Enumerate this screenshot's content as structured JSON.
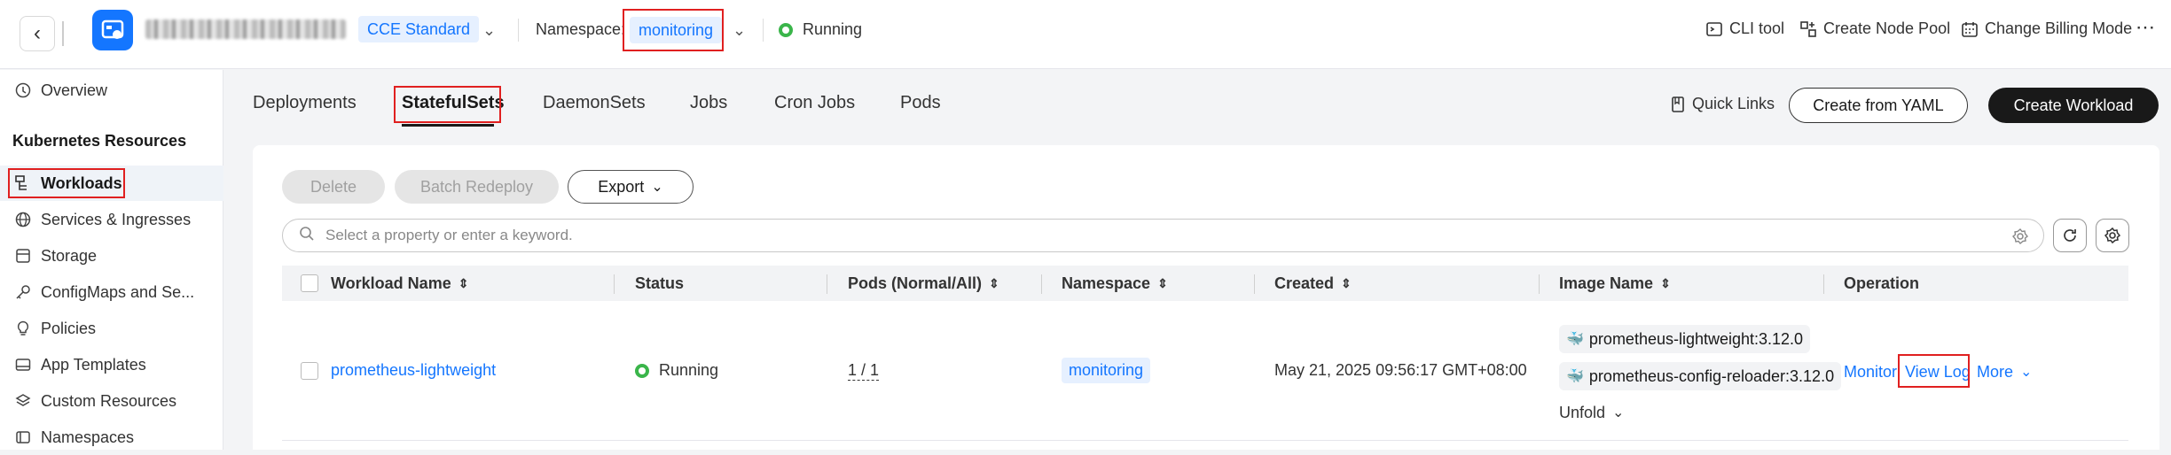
{
  "topbar": {
    "edition": "CCE Standard",
    "namespace_label": "Namespace:",
    "namespace_value": "monitoring",
    "cluster_status": "Running",
    "tools": {
      "cli": "CLI tool",
      "node_pool": "Create Node Pool",
      "billing": "Change Billing Mode",
      "more": "⋯"
    }
  },
  "sidebar": {
    "overview": "Overview",
    "section_title": "Kubernetes Resources",
    "items": [
      "Workloads",
      "Services & Ingresses",
      "Storage",
      "ConfigMaps and Se...",
      "Policies",
      "App Templates",
      "Custom Resources",
      "Namespaces"
    ]
  },
  "tabs": [
    "Deployments",
    "StatefulSets",
    "DaemonSets",
    "Jobs",
    "Cron Jobs",
    "Pods"
  ],
  "actions": {
    "quick_links": "Quick Links",
    "create_yaml": "Create from YAML",
    "create_workload": "Create Workload",
    "delete": "Delete",
    "batch_redeploy": "Batch Redeploy",
    "export": "Export"
  },
  "search": {
    "placeholder": "Select a property or enter a keyword."
  },
  "table": {
    "headers": [
      "Workload Name",
      "Status",
      "Pods (Normal/All)",
      "Namespace",
      "Created",
      "Image Name",
      "Operation"
    ],
    "rows": [
      {
        "name": "prometheus-lightweight",
        "status": "Running",
        "pods": "1 / 1",
        "namespace": "monitoring",
        "created": "May 21, 2025 09:56:17 GMT+08:00",
        "images": [
          "prometheus-lightweight:3.12.0",
          "prometheus-config-reloader:3.12.0"
        ],
        "unfold": "Unfold",
        "ops": {
          "monitor": "Monitor",
          "view_log": "View Log",
          "more": "More"
        }
      }
    ]
  },
  "colors": {
    "accent": "#1476ff",
    "running": "#3ab54a",
    "highlight": "#e02020"
  }
}
